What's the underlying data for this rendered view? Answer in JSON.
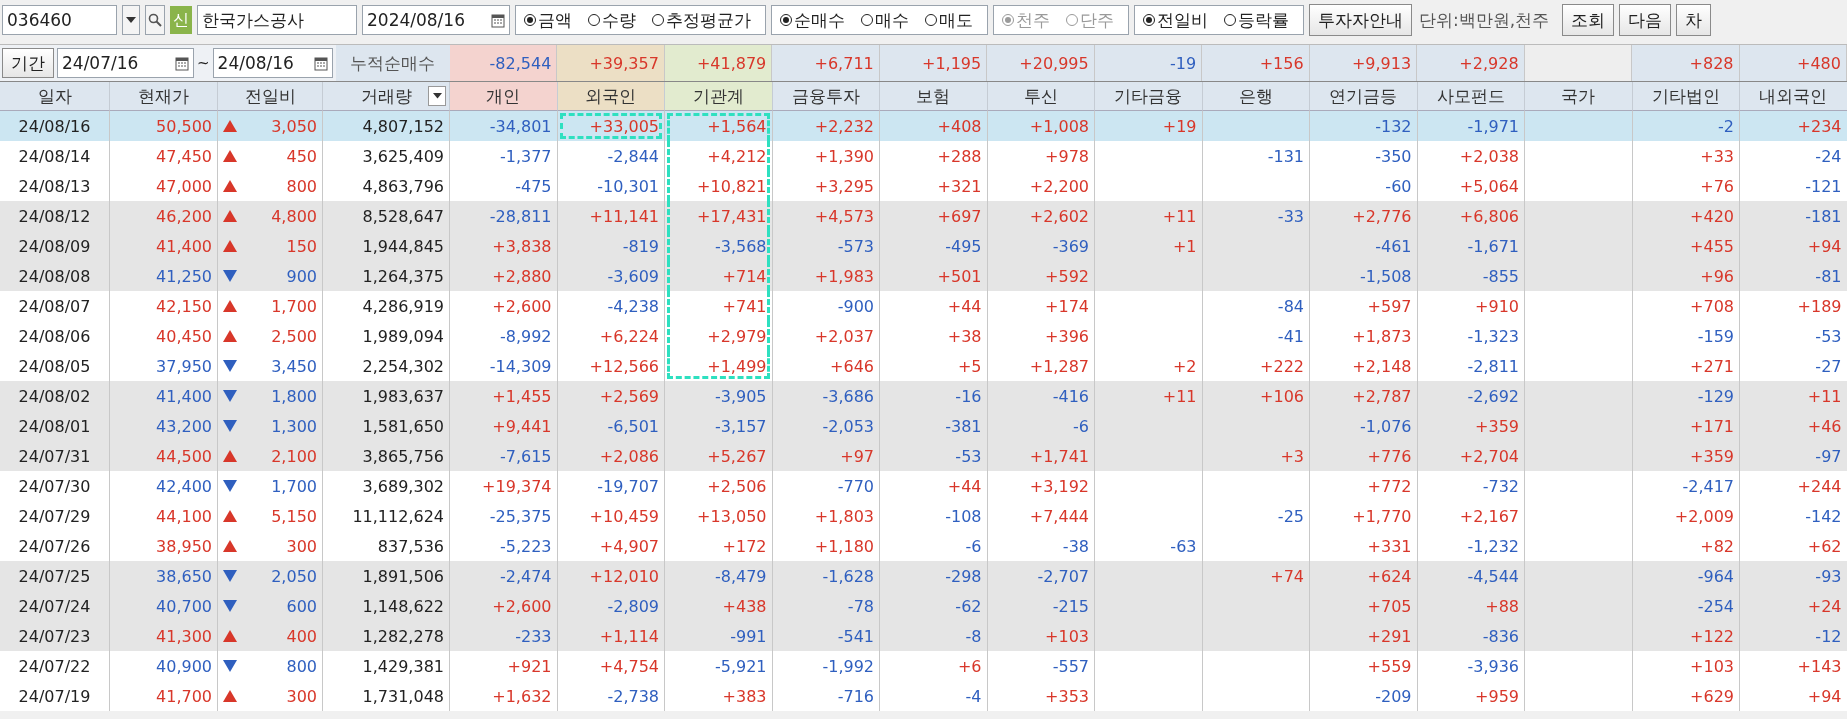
{
  "toolbar": {
    "code": "036460",
    "badge": "신",
    "name": "한국가스공사",
    "date": "2024/08/16",
    "radio_groups": [
      {
        "disabled": false,
        "options": [
          {
            "label": "금액",
            "selected": true
          },
          {
            "label": "수량",
            "selected": false
          },
          {
            "label": "추정평균가",
            "selected": false
          }
        ]
      },
      {
        "disabled": false,
        "options": [
          {
            "label": "순매수",
            "selected": true
          },
          {
            "label": "매수",
            "selected": false
          },
          {
            "label": "매도",
            "selected": false
          }
        ]
      },
      {
        "disabled": true,
        "options": [
          {
            "label": "천주",
            "selected": true
          },
          {
            "label": "단주",
            "selected": false
          }
        ]
      },
      {
        "disabled": false,
        "options": [
          {
            "label": "전일비",
            "selected": true
          },
          {
            "label": "등락률",
            "selected": false
          }
        ]
      }
    ],
    "guide_button": "투자자안내",
    "unit": "단위:백만원,천주",
    "buttons": [
      "조회",
      "다음",
      "차"
    ]
  },
  "period": {
    "label": "기간",
    "from": "24/07/16",
    "separator": "~",
    "to": "24/08/16",
    "summary_label": "누적순매수",
    "summary": {
      "individual": "-82,544",
      "foreign": "+39,357",
      "institution": "+41,879",
      "financial_investment": "+6,711",
      "insurance": "+1,195",
      "investment_trust": "+20,995",
      "other_finance": "-19",
      "bank": "+156",
      "pension": "+9,913",
      "private_fund": "+2,928",
      "other_corporation": "+828",
      "domestic_foreign": "+480"
    }
  },
  "columns": [
    {
      "label": "일자",
      "kind": "plain",
      "color": "#dde6ef"
    },
    {
      "label": "현재가",
      "kind": "plain",
      "color": "#dde6ef"
    },
    {
      "label": "전일비",
      "kind": "plain",
      "color": "#dde6ef"
    },
    {
      "label": "거래량",
      "kind": "dropdown",
      "color": "#dde6ef"
    },
    {
      "label": "개인",
      "kind": "plain",
      "color": "#f4d3cf"
    },
    {
      "label": "외국인",
      "kind": "plain",
      "color": "#ecdfc5"
    },
    {
      "label": "기관계",
      "kind": "plain",
      "color": "#e2ebcf"
    },
    {
      "label": "금융투자",
      "kind": "plain",
      "color": "#dde6ef"
    },
    {
      "label": "보험",
      "kind": "plain",
      "color": "#dde6ef"
    },
    {
      "label": "투신",
      "kind": "plain",
      "color": "#dde6ef"
    },
    {
      "label": "기타금융",
      "kind": "plain",
      "color": "#dde6ef"
    },
    {
      "label": "은행",
      "kind": "plain",
      "color": "#dde6ef"
    },
    {
      "label": "연기금등",
      "kind": "plain",
      "color": "#dde6ef"
    },
    {
      "label": "사모펀드",
      "kind": "plain",
      "color": "#dde6ef"
    },
    {
      "label": "국가",
      "kind": "plain",
      "color": "#dde6ef"
    },
    {
      "label": "기타법인",
      "kind": "plain",
      "color": "#dde6ef"
    },
    {
      "label": "내외국인",
      "kind": "plain",
      "color": "#dde6ef"
    }
  ],
  "rows": [
    {
      "date": "24/08/16",
      "price": "50,500",
      "change": "3,050",
      "rising": true,
      "volume": "4,807,152",
      "selected": true,
      "foreign_outlined": true,
      "institution_outlined": true,
      "values": {
        "individual": "-34,801",
        "foreign": "+33,005",
        "institution": "+1,564",
        "financial_investment": "+2,232",
        "insurance": "+408",
        "investment_trust": "+1,008",
        "other_finance": "+19",
        "pension": "-132",
        "private_fund": "-1,971",
        "other_corporation": "-2",
        "domestic_foreign": "+234"
      }
    },
    {
      "date": "24/08/14",
      "price": "47,450",
      "change": "450",
      "rising": true,
      "volume": "3,625,409",
      "selected": false,
      "foreign_outlined": false,
      "institution_outlined": true,
      "values": {
        "individual": "-1,377",
        "foreign": "-2,844",
        "institution": "+4,212",
        "financial_investment": "+1,390",
        "insurance": "+288",
        "investment_trust": "+978",
        "bank": "-131",
        "pension": "-350",
        "private_fund": "+2,038",
        "other_corporation": "+33",
        "domestic_foreign": "-24"
      }
    },
    {
      "date": "24/08/13",
      "price": "47,000",
      "change": "800",
      "rising": true,
      "volume": "4,863,796",
      "selected": false,
      "foreign_outlined": false,
      "institution_outlined": true,
      "values": {
        "individual": "-475",
        "foreign": "-10,301",
        "institution": "+10,821",
        "financial_investment": "+3,295",
        "insurance": "+321",
        "investment_trust": "+2,200",
        "pension": "-60",
        "private_fund": "+5,064",
        "other_corporation": "+76",
        "domestic_foreign": "-121"
      }
    },
    {
      "date": "24/08/12",
      "price": "46,200",
      "change": "4,800",
      "rising": true,
      "volume": "8,528,647",
      "selected": false,
      "foreign_outlined": false,
      "institution_outlined": true,
      "values": {
        "individual": "-28,811",
        "foreign": "+11,141",
        "institution": "+17,431",
        "financial_investment": "+4,573",
        "insurance": "+697",
        "investment_trust": "+2,602",
        "other_finance": "+11",
        "bank": "-33",
        "pension": "+2,776",
        "private_fund": "+6,806",
        "other_corporation": "+420",
        "domestic_foreign": "-181"
      }
    },
    {
      "date": "24/08/09",
      "price": "41,400",
      "change": "150",
      "rising": true,
      "volume": "1,944,845",
      "selected": false,
      "foreign_outlined": false,
      "institution_outlined": true,
      "values": {
        "individual": "+3,838",
        "foreign": "-819",
        "institution": "-3,568",
        "financial_investment": "-573",
        "insurance": "-495",
        "investment_trust": "-369",
        "other_finance": "+1",
        "pension": "-461",
        "private_fund": "-1,671",
        "other_corporation": "+455",
        "domestic_foreign": "+94"
      }
    },
    {
      "date": "24/08/08",
      "price": "41,250",
      "change": "900",
      "rising": false,
      "volume": "1,264,375",
      "selected": false,
      "foreign_outlined": false,
      "institution_outlined": true,
      "values": {
        "individual": "+2,880",
        "foreign": "-3,609",
        "institution": "+714",
        "financial_investment": "+1,983",
        "insurance": "+501",
        "investment_trust": "+592",
        "pension": "-1,508",
        "private_fund": "-855",
        "other_corporation": "+96",
        "domestic_foreign": "-81"
      }
    },
    {
      "date": "24/08/07",
      "price": "42,150",
      "change": "1,700",
      "rising": true,
      "volume": "4,286,919",
      "selected": false,
      "foreign_outlined": false,
      "institution_outlined": true,
      "values": {
        "individual": "+2,600",
        "foreign": "-4,238",
        "institution": "+741",
        "financial_investment": "-900",
        "insurance": "+44",
        "investment_trust": "+174",
        "bank": "-84",
        "pension": "+597",
        "private_fund": "+910",
        "other_corporation": "+708",
        "domestic_foreign": "+189"
      }
    },
    {
      "date": "24/08/06",
      "price": "40,450",
      "change": "2,500",
      "rising": true,
      "volume": "1,989,094",
      "selected": false,
      "foreign_outlined": false,
      "institution_outlined": true,
      "values": {
        "individual": "-8,992",
        "foreign": "+6,224",
        "institution": "+2,979",
        "financial_investment": "+2,037",
        "insurance": "+38",
        "investment_trust": "+396",
        "bank": "-41",
        "pension": "+1,873",
        "private_fund": "-1,323",
        "other_corporation": "-159",
        "domestic_foreign": "-53"
      }
    },
    {
      "date": "24/08/05",
      "price": "37,950",
      "change": "3,450",
      "rising": false,
      "volume": "2,254,302",
      "selected": false,
      "foreign_outlined": false,
      "institution_outlined": true,
      "values": {
        "individual": "-14,309",
        "foreign": "+12,566",
        "institution": "+1,499",
        "financial_investment": "+646",
        "insurance": "+5",
        "investment_trust": "+1,287",
        "other_finance": "+2",
        "bank": "+222",
        "pension": "+2,148",
        "private_fund": "-2,811",
        "other_corporation": "+271",
        "domestic_foreign": "-27"
      }
    },
    {
      "date": "24/08/02",
      "price": "41,400",
      "change": "1,800",
      "rising": false,
      "volume": "1,983,637",
      "selected": false,
      "foreign_outlined": false,
      "institution_outlined": false,
      "values": {
        "individual": "+1,455",
        "foreign": "+2,569",
        "institution": "-3,905",
        "financial_investment": "-3,686",
        "insurance": "-16",
        "investment_trust": "-416",
        "other_finance": "+11",
        "bank": "+106",
        "pension": "+2,787",
        "private_fund": "-2,692",
        "other_corporation": "-129",
        "domestic_foreign": "+11"
      }
    },
    {
      "date": "24/08/01",
      "price": "43,200",
      "change": "1,300",
      "rising": false,
      "volume": "1,581,650",
      "selected": false,
      "foreign_outlined": false,
      "institution_outlined": false,
      "values": {
        "individual": "+9,441",
        "foreign": "-6,501",
        "institution": "-3,157",
        "financial_investment": "-2,053",
        "insurance": "-381",
        "investment_trust": "-6",
        "pension": "-1,076",
        "private_fund": "+359",
        "other_corporation": "+171",
        "domestic_foreign": "+46"
      }
    },
    {
      "date": "24/07/31",
      "price": "44,500",
      "change": "2,100",
      "rising": true,
      "volume": "3,865,756",
      "selected": false,
      "foreign_outlined": false,
      "institution_outlined": false,
      "values": {
        "individual": "-7,615",
        "foreign": "+2,086",
        "institution": "+5,267",
        "financial_investment": "+97",
        "insurance": "-53",
        "investment_trust": "+1,741",
        "bank": "+3",
        "pension": "+776",
        "private_fund": "+2,704",
        "other_corporation": "+359",
        "domestic_foreign": "-97"
      }
    },
    {
      "date": "24/07/30",
      "price": "42,400",
      "change": "1,700",
      "rising": false,
      "volume": "3,689,302",
      "selected": false,
      "foreign_outlined": false,
      "institution_outlined": false,
      "values": {
        "individual": "+19,374",
        "foreign": "-19,707",
        "institution": "+2,506",
        "financial_investment": "-770",
        "insurance": "+44",
        "investment_trust": "+3,192",
        "pension": "+772",
        "private_fund": "-732",
        "other_corporation": "-2,417",
        "domestic_foreign": "+244"
      }
    },
    {
      "date": "24/07/29",
      "price": "44,100",
      "change": "5,150",
      "rising": true,
      "volume": "11,112,624",
      "selected": false,
      "foreign_outlined": false,
      "institution_outlined": false,
      "values": {
        "individual": "-25,375",
        "foreign": "+10,459",
        "institution": "+13,050",
        "financial_investment": "+1,803",
        "insurance": "-108",
        "investment_trust": "+7,444",
        "bank": "-25",
        "pension": "+1,770",
        "private_fund": "+2,167",
        "other_corporation": "+2,009",
        "domestic_foreign": "-142"
      }
    },
    {
      "date": "24/07/26",
      "price": "38,950",
      "change": "300",
      "rising": true,
      "volume": "837,536",
      "selected": false,
      "foreign_outlined": false,
      "institution_outlined": false,
      "values": {
        "individual": "-5,223",
        "foreign": "+4,907",
        "institution": "+172",
        "financial_investment": "+1,180",
        "insurance": "-6",
        "investment_trust": "-38",
        "other_finance": "-63",
        "pension": "+331",
        "private_fund": "-1,232",
        "other_corporation": "+82",
        "domestic_foreign": "+62"
      }
    },
    {
      "date": "24/07/25",
      "price": "38,650",
      "change": "2,050",
      "rising": false,
      "volume": "1,891,506",
      "selected": false,
      "foreign_outlined": false,
      "institution_outlined": false,
      "values": {
        "individual": "-2,474",
        "foreign": "+12,010",
        "institution": "-8,479",
        "financial_investment": "-1,628",
        "insurance": "-298",
        "investment_trust": "-2,707",
        "bank": "+74",
        "pension": "+624",
        "private_fund": "-4,544",
        "other_corporation": "-964",
        "domestic_foreign": "-93"
      }
    },
    {
      "date": "24/07/24",
      "price": "40,700",
      "change": "600",
      "rising": false,
      "volume": "1,148,622",
      "selected": false,
      "foreign_outlined": false,
      "institution_outlined": false,
      "values": {
        "individual": "+2,600",
        "foreign": "-2,809",
        "institution": "+438",
        "financial_investment": "-78",
        "insurance": "-62",
        "investment_trust": "-215",
        "pension": "+705",
        "private_fund": "+88",
        "other_corporation": "-254",
        "domestic_foreign": "+24"
      }
    },
    {
      "date": "24/07/23",
      "price": "41,300",
      "change": "400",
      "rising": true,
      "volume": "1,282,278",
      "selected": false,
      "foreign_outlined": false,
      "institution_outlined": false,
      "values": {
        "individual": "-233",
        "foreign": "+1,114",
        "institution": "-991",
        "financial_investment": "-541",
        "insurance": "-8",
        "investment_trust": "+103",
        "pension": "+291",
        "private_fund": "-836",
        "other_corporation": "+122",
        "domestic_foreign": "-12"
      }
    },
    {
      "date": "24/07/22",
      "price": "40,900",
      "change": "800",
      "rising": false,
      "volume": "1,429,381",
      "selected": false,
      "foreign_outlined": false,
      "institution_outlined": false,
      "values": {
        "individual": "+921",
        "foreign": "+4,754",
        "institution": "-5,921",
        "financial_investment": "-1,992",
        "insurance": "+6",
        "investment_trust": "-557",
        "pension": "+559",
        "private_fund": "-3,936",
        "other_corporation": "+103",
        "domestic_foreign": "+143"
      }
    },
    {
      "date": "24/07/19",
      "price": "41,700",
      "change": "300",
      "rising": true,
      "volume": "1,731,048",
      "selected": false,
      "foreign_outlined": false,
      "institution_outlined": false,
      "values": {
        "individual": "+1,632",
        "foreign": "-2,738",
        "institution": "+383",
        "financial_investment": "-716",
        "insurance": "-4",
        "investment_trust": "+353",
        "pension": "-209",
        "private_fund": "+959",
        "other_corporation": "+629",
        "domestic_foreign": "+94"
      }
    }
  ]
}
